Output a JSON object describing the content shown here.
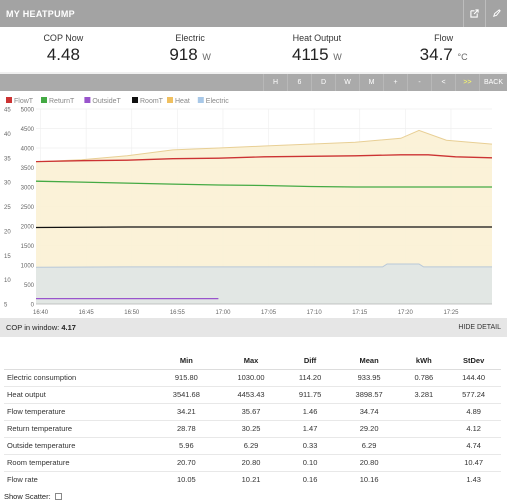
{
  "header": {
    "title": "MY HEATPUMP",
    "icons": [
      "external-link-icon",
      "edit-icon"
    ]
  },
  "stats": [
    {
      "label": "COP Now",
      "value": "4.48",
      "unit": ""
    },
    {
      "label": "Electric",
      "value": "918",
      "unit": "W"
    },
    {
      "label": "Heat Output",
      "value": "4115",
      "unit": "W"
    },
    {
      "label": "Flow",
      "value": "34.7",
      "unit": "°C"
    }
  ],
  "toolbar": [
    "H",
    "6",
    "D",
    "W",
    "M",
    "+",
    "-",
    "<",
    ">>",
    "BACK"
  ],
  "chart_data": {
    "type": "line",
    "legend": [
      {
        "name": "FlowT",
        "color": "#cc3333"
      },
      {
        "name": "ReturnT",
        "color": "#44aa44"
      },
      {
        "name": "OutsideT",
        "color": "#9955cc"
      },
      {
        "name": "RoomT",
        "color": "#111111"
      },
      {
        "name": "Heat",
        "color": "#f0c060"
      },
      {
        "name": "Electric",
        "color": "#a8c8e8"
      }
    ],
    "y_left_ticks": [
      "0",
      "500",
      "1000",
      "1500",
      "2000",
      "2500",
      "3000",
      "3500",
      "4000",
      "4500",
      "5000"
    ],
    "y_right_ticks": [
      "5",
      "10",
      "15",
      "20",
      "25",
      "30",
      "35",
      "40",
      "45"
    ],
    "x_ticks": [
      "16:40",
      "16:45",
      "16:50",
      "16:55",
      "17:00",
      "17:05",
      "17:10",
      "17:15",
      "17:20",
      "17:25"
    ],
    "x_range_min": [
      0,
      50
    ],
    "ylim_left": [
      0,
      5000
    ],
    "ylim_right": [
      5,
      45
    ],
    "series": [
      {
        "name": "FlowT",
        "axis": "right",
        "points": [
          [
            0,
            34.2
          ],
          [
            5,
            34.4
          ],
          [
            10,
            34.5
          ],
          [
            15,
            34.8
          ],
          [
            20,
            34.9
          ],
          [
            25,
            35.2
          ],
          [
            30,
            35.3
          ],
          [
            35,
            35.4
          ],
          [
            40,
            35.6
          ],
          [
            43,
            35.6
          ],
          [
            46,
            35.2
          ],
          [
            50,
            35.0
          ]
        ]
      },
      {
        "name": "ReturnT",
        "axis": "right",
        "points": [
          [
            0,
            30.2
          ],
          [
            5,
            30.0
          ],
          [
            10,
            29.8
          ],
          [
            15,
            29.6
          ],
          [
            20,
            29.4
          ],
          [
            25,
            29.3
          ],
          [
            30,
            29.1
          ],
          [
            35,
            29.0
          ],
          [
            40,
            29.0
          ],
          [
            45,
            29.0
          ],
          [
            50,
            29.0
          ]
        ]
      },
      {
        "name": "OutsideT",
        "axis": "right",
        "points": [
          [
            0,
            6.1
          ],
          [
            10,
            6.1
          ],
          [
            20,
            6.1
          ],
          [
            20.1,
            null
          ]
        ]
      },
      {
        "name": "RoomT",
        "axis": "right",
        "points": [
          [
            0,
            20.7
          ],
          [
            10,
            20.8
          ],
          [
            20,
            20.8
          ],
          [
            30,
            20.8
          ],
          [
            40,
            20.8
          ],
          [
            50,
            20.8
          ]
        ]
      },
      {
        "name": "Heat",
        "axis": "left",
        "points": [
          [
            0,
            3650
          ],
          [
            5,
            3700
          ],
          [
            10,
            3800
          ],
          [
            15,
            3950
          ],
          [
            20,
            4000
          ],
          [
            25,
            4050
          ],
          [
            30,
            4100
          ],
          [
            35,
            4150
          ],
          [
            40,
            4250
          ],
          [
            42,
            4450
          ],
          [
            45,
            4200
          ],
          [
            50,
            4100
          ]
        ]
      },
      {
        "name": "Electric",
        "axis": "left",
        "points": [
          [
            0,
            940
          ],
          [
            10,
            950
          ],
          [
            20,
            950
          ],
          [
            30,
            950
          ],
          [
            38,
            950
          ],
          [
            38.5,
            1025
          ],
          [
            42,
            1025
          ],
          [
            42.5,
            950
          ],
          [
            50,
            950
          ]
        ]
      }
    ]
  },
  "info": {
    "cop_label": "COP in window:",
    "cop_value": "4.17",
    "hide": "HIDE DETAIL"
  },
  "table": {
    "headers": [
      "",
      "Min",
      "Max",
      "Diff",
      "Mean",
      "kWh",
      "StDev"
    ],
    "rows": [
      [
        "Electric consumption",
        "915.80",
        "1030.00",
        "114.20",
        "933.95",
        "0.786",
        "144.40"
      ],
      [
        "Heat output",
        "3541.68",
        "4453.43",
        "911.75",
        "3898.57",
        "3.281",
        "577.24"
      ],
      [
        "Flow temperature",
        "34.21",
        "35.67",
        "1.46",
        "34.74",
        "",
        "4.89"
      ],
      [
        "Return temperature",
        "28.78",
        "30.25",
        "1.47",
        "29.20",
        "",
        "4.12"
      ],
      [
        "Outside temperature",
        "5.96",
        "6.29",
        "0.33",
        "6.29",
        "",
        "4.74"
      ],
      [
        "Room temperature",
        "20.70",
        "20.80",
        "0.10",
        "20.80",
        "",
        "10.47"
      ],
      [
        "Flow rate",
        "10.05",
        "10.21",
        "0.16",
        "10.16",
        "",
        "1.43"
      ]
    ]
  },
  "footer": {
    "scatter_label": "Show Scatter:"
  }
}
